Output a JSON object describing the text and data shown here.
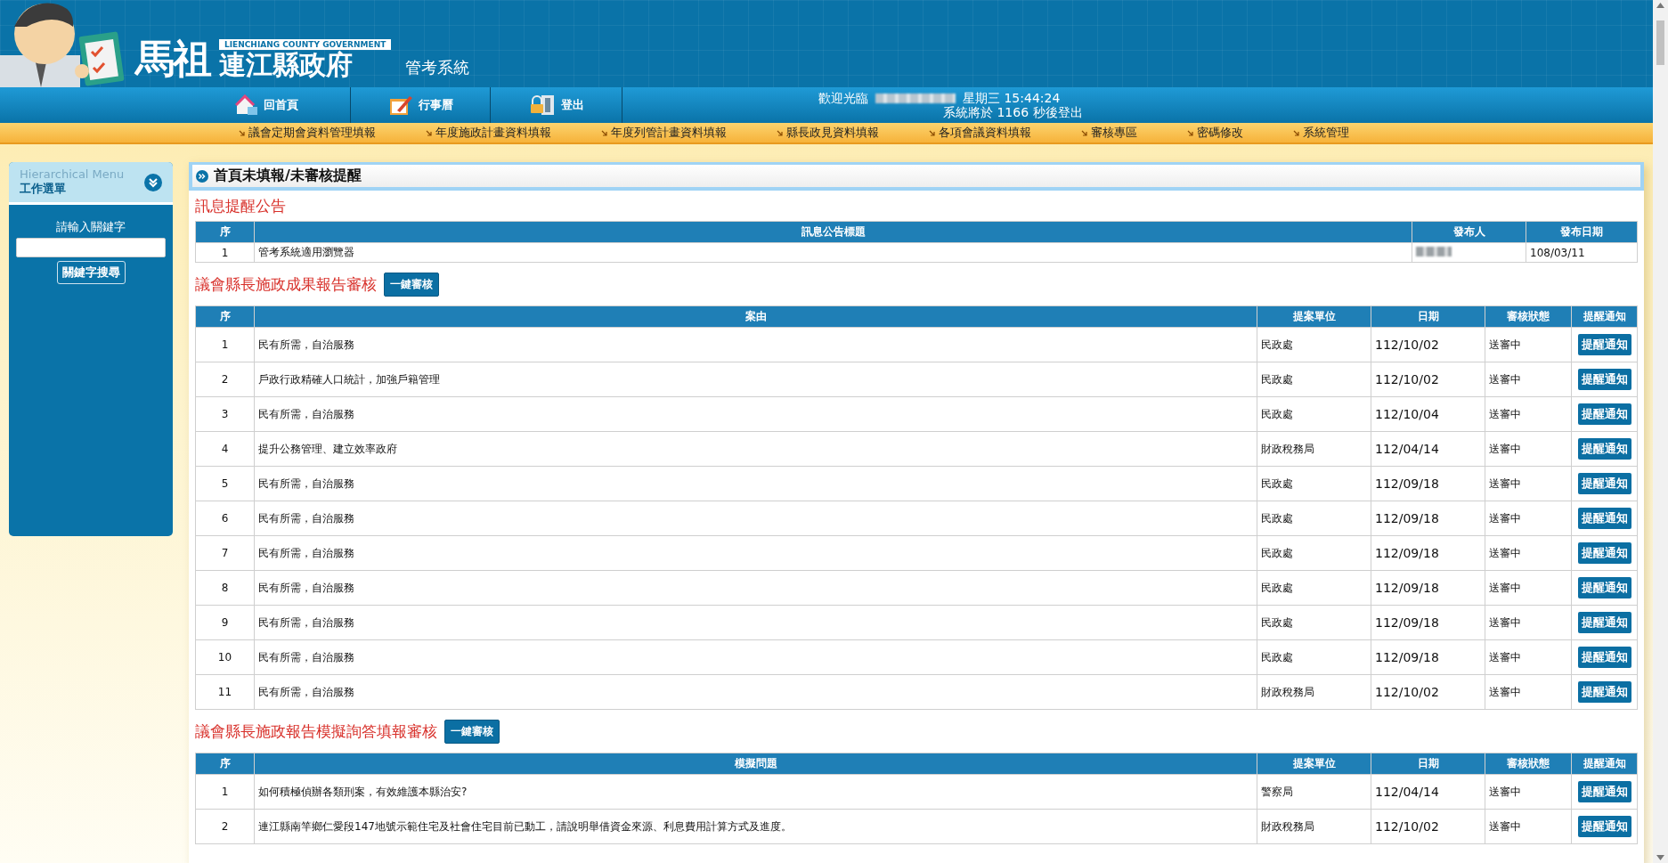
{
  "header": {
    "logo_mark": "馬祖",
    "logo_caption": "LIENCHIANG COUNTY GOVERNMENT",
    "logo_title": "連江縣政府",
    "system_name": "管考系統"
  },
  "nav_buttons": [
    {
      "label": "回首頁",
      "kind": "home"
    },
    {
      "label": "行事曆",
      "kind": "calendar"
    },
    {
      "label": "登出",
      "kind": "logout"
    }
  ],
  "user_info": {
    "welcome": "歡迎光臨",
    "name_redacted": true,
    "day_time": "星期三 15:44:24",
    "logout_notice": "系統將於 1166 秒後登出"
  },
  "menu": [
    "議會定期會資料管理填報",
    "年度施政計畫資料填報",
    "年度列管計畫資料填報",
    "縣長政見資料填報",
    "各項會議資料填報",
    "審核專區",
    "密碼修改",
    "系統管理"
  ],
  "sidebar": {
    "title_en": "Hierarchical Menu",
    "title": "工作選單",
    "search_label": "請輸入關鍵字",
    "search_button": "關鍵字搜尋"
  },
  "panel_title": "首頁未填報/未審核提醒",
  "sections": [
    {
      "kind": "notice",
      "title": "訊息提醒公告",
      "columns": [
        "序",
        "訊息公告標題",
        "發布人",
        "發布日期"
      ],
      "rows": [
        {
          "no": "1",
          "title": "管考系統適用瀏覽器",
          "publisher_redacted": true,
          "date": "108/03/11"
        }
      ]
    },
    {
      "kind": "review",
      "title": "議會縣長施政成果報告審核",
      "action_button": "一鍵審核",
      "columns": [
        "序",
        "案由",
        "提案單位",
        "日期",
        "審核狀態",
        "提醒通知"
      ],
      "rows": [
        {
          "no": "1",
          "subject": "民有所需，自治服務",
          "unit": "民政處",
          "date": "112/10/02",
          "status": "送審中",
          "button": "提醒通知"
        },
        {
          "no": "2",
          "subject": "戶政行政精確人口統計，加強戶籍管理",
          "unit": "民政處",
          "date": "112/10/02",
          "status": "送審中",
          "button": "提醒通知"
        },
        {
          "no": "3",
          "subject": "民有所需，自治服務",
          "unit": "民政處",
          "date": "112/10/04",
          "status": "送審中",
          "button": "提醒通知"
        },
        {
          "no": "4",
          "subject": "提升公務管理、建立效率政府",
          "unit": "財政稅務局",
          "date": "112/04/14",
          "status": "送審中",
          "button": "提醒通知"
        },
        {
          "no": "5",
          "subject": "民有所需，自治服務",
          "unit": "民政處",
          "date": "112/09/18",
          "status": "送審中",
          "button": "提醒通知"
        },
        {
          "no": "6",
          "subject": "民有所需，自治服務",
          "unit": "民政處",
          "date": "112/09/18",
          "status": "送審中",
          "button": "提醒通知"
        },
        {
          "no": "7",
          "subject": "民有所需，自治服務",
          "unit": "民政處",
          "date": "112/09/18",
          "status": "送審中",
          "button": "提醒通知"
        },
        {
          "no": "8",
          "subject": "民有所需，自治服務",
          "unit": "民政處",
          "date": "112/09/18",
          "status": "送審中",
          "button": "提醒通知"
        },
        {
          "no": "9",
          "subject": "民有所需，自治服務",
          "unit": "民政處",
          "date": "112/09/18",
          "status": "送審中",
          "button": "提醒通知"
        },
        {
          "no": "10",
          "subject": "民有所需，自治服務",
          "unit": "民政處",
          "date": "112/09/18",
          "status": "送審中",
          "button": "提醒通知"
        },
        {
          "no": "11",
          "subject": "民有所需，自治服務",
          "unit": "財政稅務局",
          "date": "112/10/02",
          "status": "送審中",
          "button": "提醒通知"
        }
      ]
    },
    {
      "kind": "review",
      "title": "議會縣長施政報告模擬詢答填報審核",
      "action_button": "一鍵審核",
      "columns": [
        "序",
        "模擬問題",
        "提案單位",
        "日期",
        "審核狀態",
        "提醒通知"
      ],
      "rows": [
        {
          "no": "1",
          "subject": "如何積極偵辦各類刑案，有效維護本縣治安?",
          "unit": "警察局",
          "date": "112/04/14",
          "status": "送審中",
          "button": "提醒通知"
        },
        {
          "no": "2",
          "subject": "連江縣南竿鄉仁愛段147地號示範住宅及社會住宅目前已動工，請說明舉借資金來源、利息費用計算方式及進度。",
          "unit": "財政稅務局",
          "date": "112/10/02",
          "status": "送審中",
          "button": "提醒通知"
        }
      ]
    }
  ]
}
